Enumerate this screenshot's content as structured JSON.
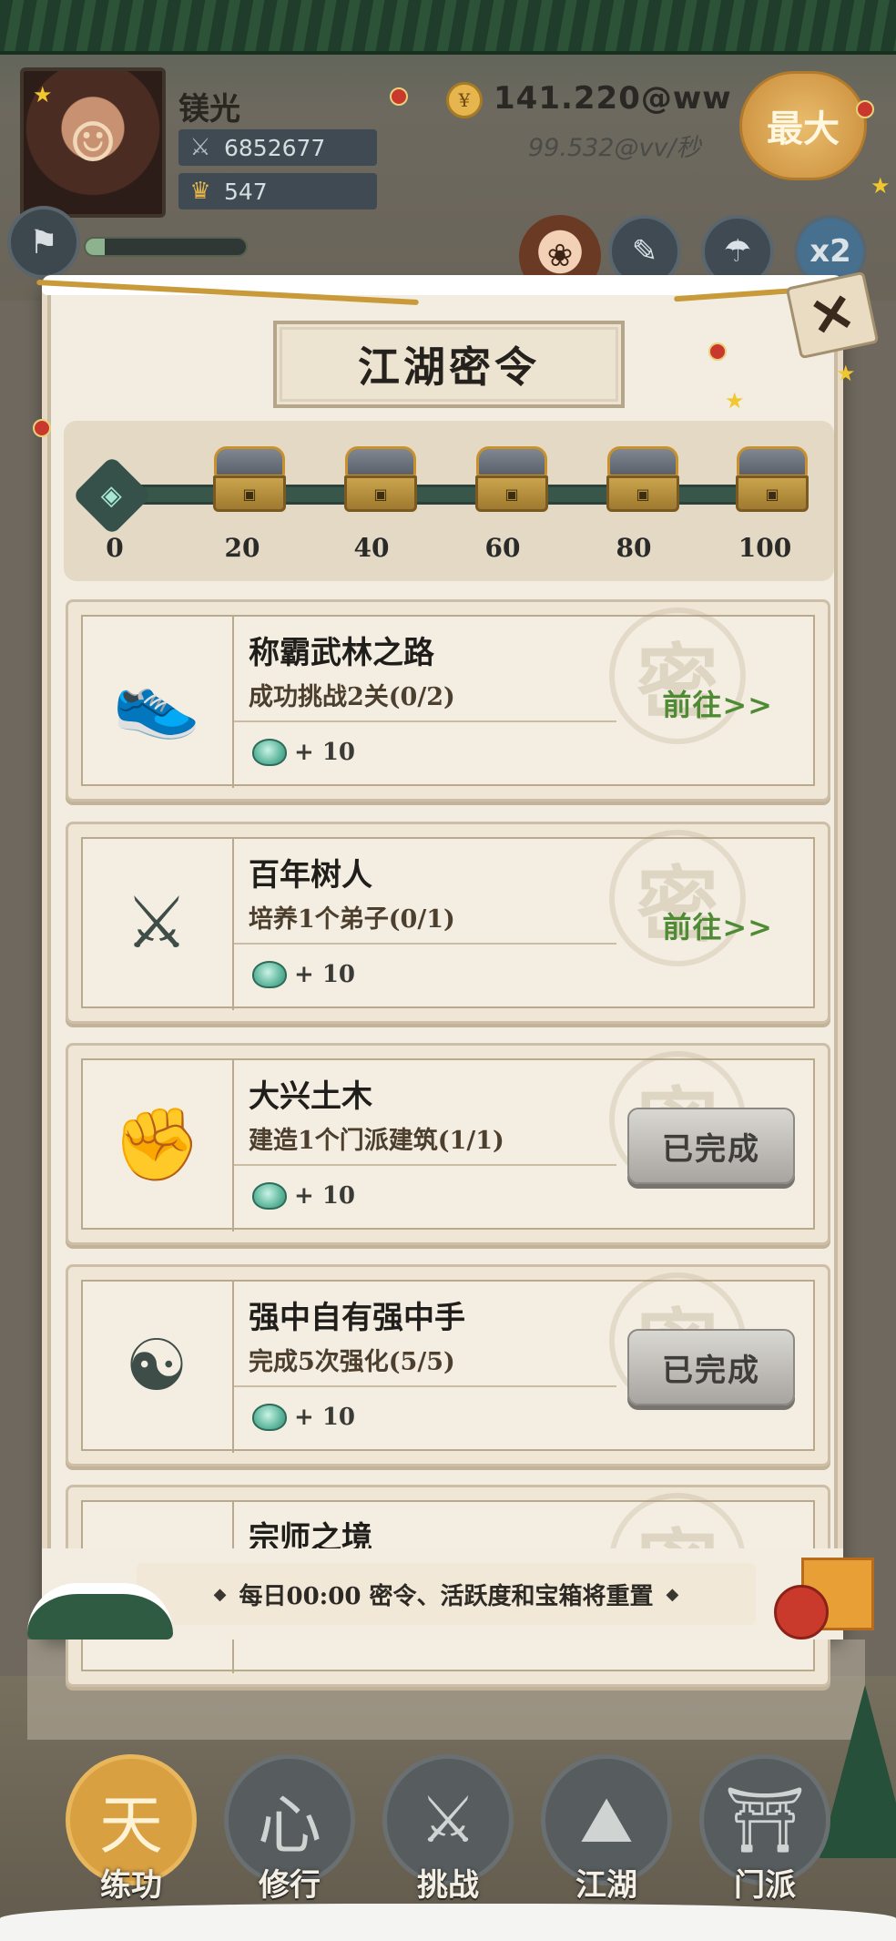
{
  "player": {
    "name": "镁光",
    "power": "6852677",
    "gold": "547",
    "icons": {
      "power": "crossed-swords-icon",
      "gold": "crown-icon"
    }
  },
  "income": {
    "total": "141.220@ww",
    "per_second": "99.532@vv/秒",
    "max_label": "最大"
  },
  "top_icons": {
    "boost_label": "x2"
  },
  "panel": {
    "title": "江湖密令",
    "close_symbol": "✕",
    "progress": {
      "current": 0,
      "milestones": [
        "0",
        "20",
        "40",
        "60",
        "80",
        "100"
      ]
    },
    "tasks": [
      {
        "name": "称霸武林之路",
        "desc": "成功挑战2关(0/2)",
        "reward": "+ 10",
        "action": "前往>>",
        "status": "go",
        "icon": "shoe-icon",
        "glyph": "👟"
      },
      {
        "name": "百年树人",
        "desc": "培养1个弟子(0/1)",
        "reward": "+ 10",
        "action": "前往>>",
        "status": "go",
        "icon": "crossed-spears-icon",
        "glyph": "⚔"
      },
      {
        "name": "大兴土木",
        "desc": "建造1个门派建筑(1/1)",
        "reward": "+ 10",
        "action": "已完成",
        "status": "done",
        "icon": "fist-icon",
        "glyph": "✊"
      },
      {
        "name": "强中自有强中手",
        "desc": "完成5次强化(5/5)",
        "reward": "+ 10",
        "action": "已完成",
        "status": "done",
        "icon": "meditating-figure-icon",
        "glyph": "☯"
      },
      {
        "name": "宗师之境",
        "desc": "",
        "reward": "",
        "action": "",
        "status": "partial",
        "icon": "scroll-icon",
        "glyph": "☁"
      }
    ],
    "seal_char": "密",
    "reset_notice": "每日00:00  密令、活跃度和宝箱将重置"
  },
  "bottom_nav": [
    {
      "label": "练功",
      "icon": "training-icon",
      "glyph": "天",
      "active": true
    },
    {
      "label": "修行",
      "icon": "heart-mind-icon",
      "glyph": "心",
      "active": false
    },
    {
      "label": "挑战",
      "icon": "crossed-swords-icon",
      "glyph": "⚔",
      "active": false
    },
    {
      "label": "江湖",
      "icon": "mountain-icon",
      "glyph": "⛰",
      "active": false
    },
    {
      "label": "门派",
      "icon": "gate-icon",
      "glyph": "⛩",
      "active": false
    }
  ],
  "colors": {
    "go_action": "#4f8a35",
    "done_button": "#a8a5a0",
    "gold_accent": "#d9a042",
    "jade": "#7cc3a2"
  }
}
